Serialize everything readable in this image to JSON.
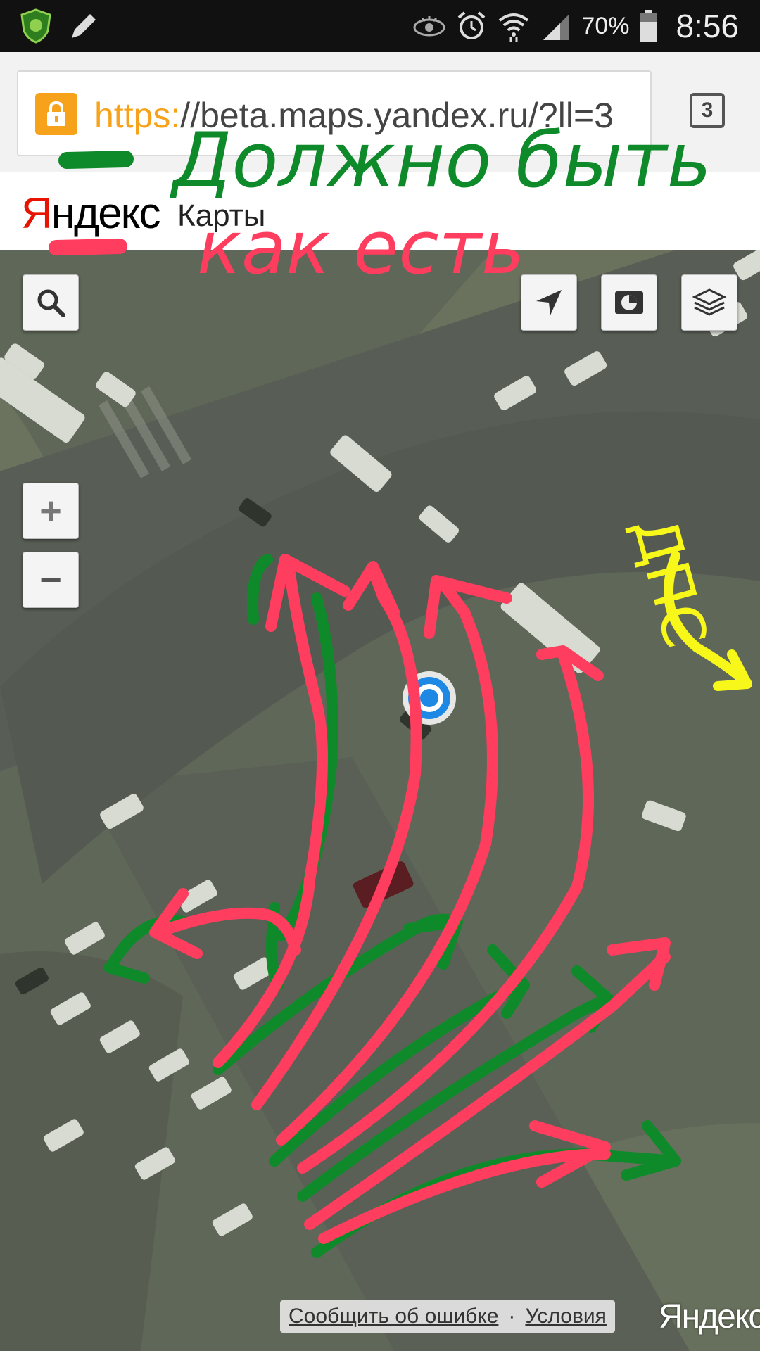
{
  "status_bar": {
    "battery": "70%",
    "time": "8:56"
  },
  "browser": {
    "url_scheme": "https:",
    "url_rest": "//beta.maps.yandex.ru/?ll=3",
    "tab_count": "3"
  },
  "yandex": {
    "logo_first": "Я",
    "logo_rest": "ндекс",
    "service": "Карты"
  },
  "map": {
    "zoom_in": "+",
    "zoom_out": "−",
    "report_error": "Сообщить об ошибке",
    "separator": "·",
    "terms": "Условия",
    "logo": "Яндекс"
  },
  "annotations": {
    "green_text": "Должно быть",
    "red_text": "как есть",
    "yellow_text": "ДПС",
    "colors": {
      "green": "#0f8a2a",
      "red": "#ff3d5e",
      "yellow": "#f7f71a"
    }
  }
}
